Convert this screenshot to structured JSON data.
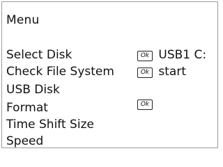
{
  "menu": {
    "title": "Menu",
    "items": [
      {
        "label": "Select  Disk",
        "ok": "Ok",
        "value": "USB1 C:"
      },
      {
        "label": "Check File System",
        "ok": "Ok",
        "value": "start"
      },
      {
        "label": "USB Disk",
        "ok": "",
        "value": ""
      },
      {
        "label": "Format",
        "ok": "Ok",
        "value": ""
      },
      {
        "label": "Time Shift Size",
        "ok": "",
        "value": ""
      },
      {
        "label": "Speed",
        "ok": "",
        "value": ""
      }
    ]
  }
}
